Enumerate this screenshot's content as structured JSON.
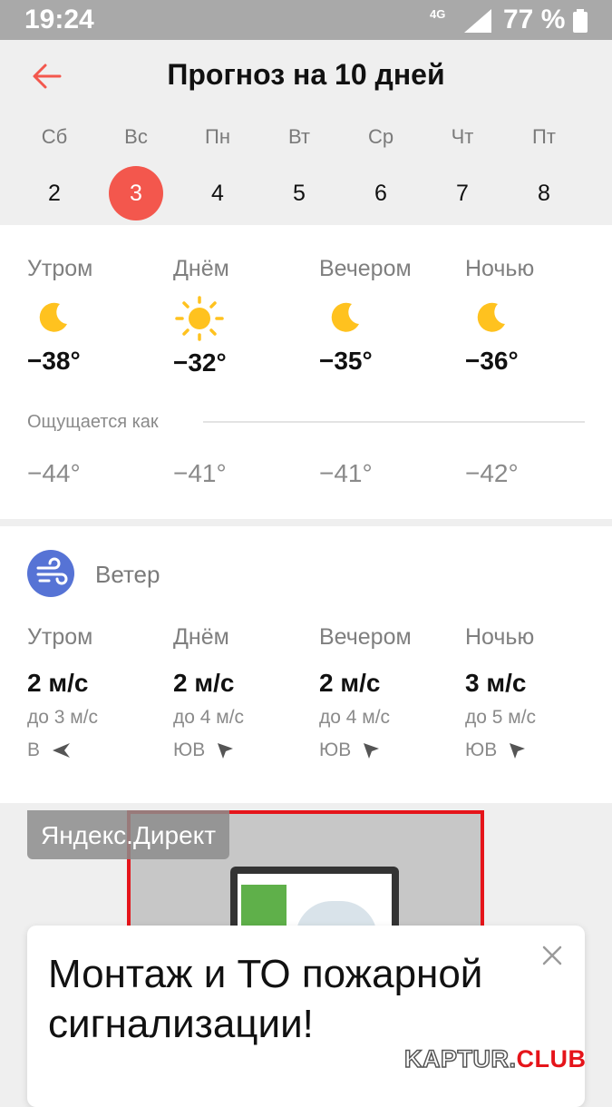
{
  "status_bar": {
    "time": "19:24",
    "network": "4G",
    "battery": "77 %"
  },
  "header": {
    "title": "Прогноз на 10 дней",
    "back_icon": "arrow-left-icon",
    "accent_color": "#f3574d"
  },
  "days": [
    {
      "dow": "Сб",
      "num": "2",
      "active": false
    },
    {
      "dow": "Вс",
      "num": "3",
      "active": true
    },
    {
      "dow": "Пн",
      "num": "4",
      "active": false
    },
    {
      "dow": "Вт",
      "num": "5",
      "active": false
    },
    {
      "dow": "Ср",
      "num": "6",
      "active": false
    },
    {
      "dow": "Чт",
      "num": "7",
      "active": false
    },
    {
      "dow": "Пт",
      "num": "8",
      "active": false
    }
  ],
  "temperatures": {
    "parts": [
      {
        "label": "Утром",
        "icon": "moon-icon",
        "temp": "−38°",
        "feels": "−44°"
      },
      {
        "label": "Днём",
        "icon": "sun-icon",
        "temp": "−32°",
        "feels": "−41°"
      },
      {
        "label": "Вечером",
        "icon": "moon-icon",
        "temp": "−35°",
        "feels": "−41°"
      },
      {
        "label": "Ночью",
        "icon": "moon-icon",
        "temp": "−36°",
        "feels": "−42°"
      }
    ],
    "feels_label": "Ощущается как"
  },
  "wind": {
    "title": "Ветер",
    "icon": "wind-icon",
    "parts": [
      {
        "label": "Утром",
        "speed": "2 м/с",
        "gust": "до 3 м/с",
        "dir": "В"
      },
      {
        "label": "Днём",
        "speed": "2 м/с",
        "gust": "до 4 м/с",
        "dir": "ЮВ"
      },
      {
        "label": "Вечером",
        "speed": "2 м/с",
        "gust": "до 4 м/с",
        "dir": "ЮВ"
      },
      {
        "label": "Ночью",
        "speed": "3 м/с",
        "gust": "до 5 м/с",
        "dir": "ЮВ"
      }
    ]
  },
  "ad": {
    "label": "Яндекс.Директ",
    "headline": "Монтаж и ТО пожарной сигнализации!"
  },
  "watermark": {
    "part1": "KAPTUR.",
    "part2": "CLUB"
  },
  "colors": {
    "accent": "#f3574d",
    "wind_badge": "#5673d5",
    "sun": "#ffc21f",
    "moon": "#ffc21f"
  }
}
